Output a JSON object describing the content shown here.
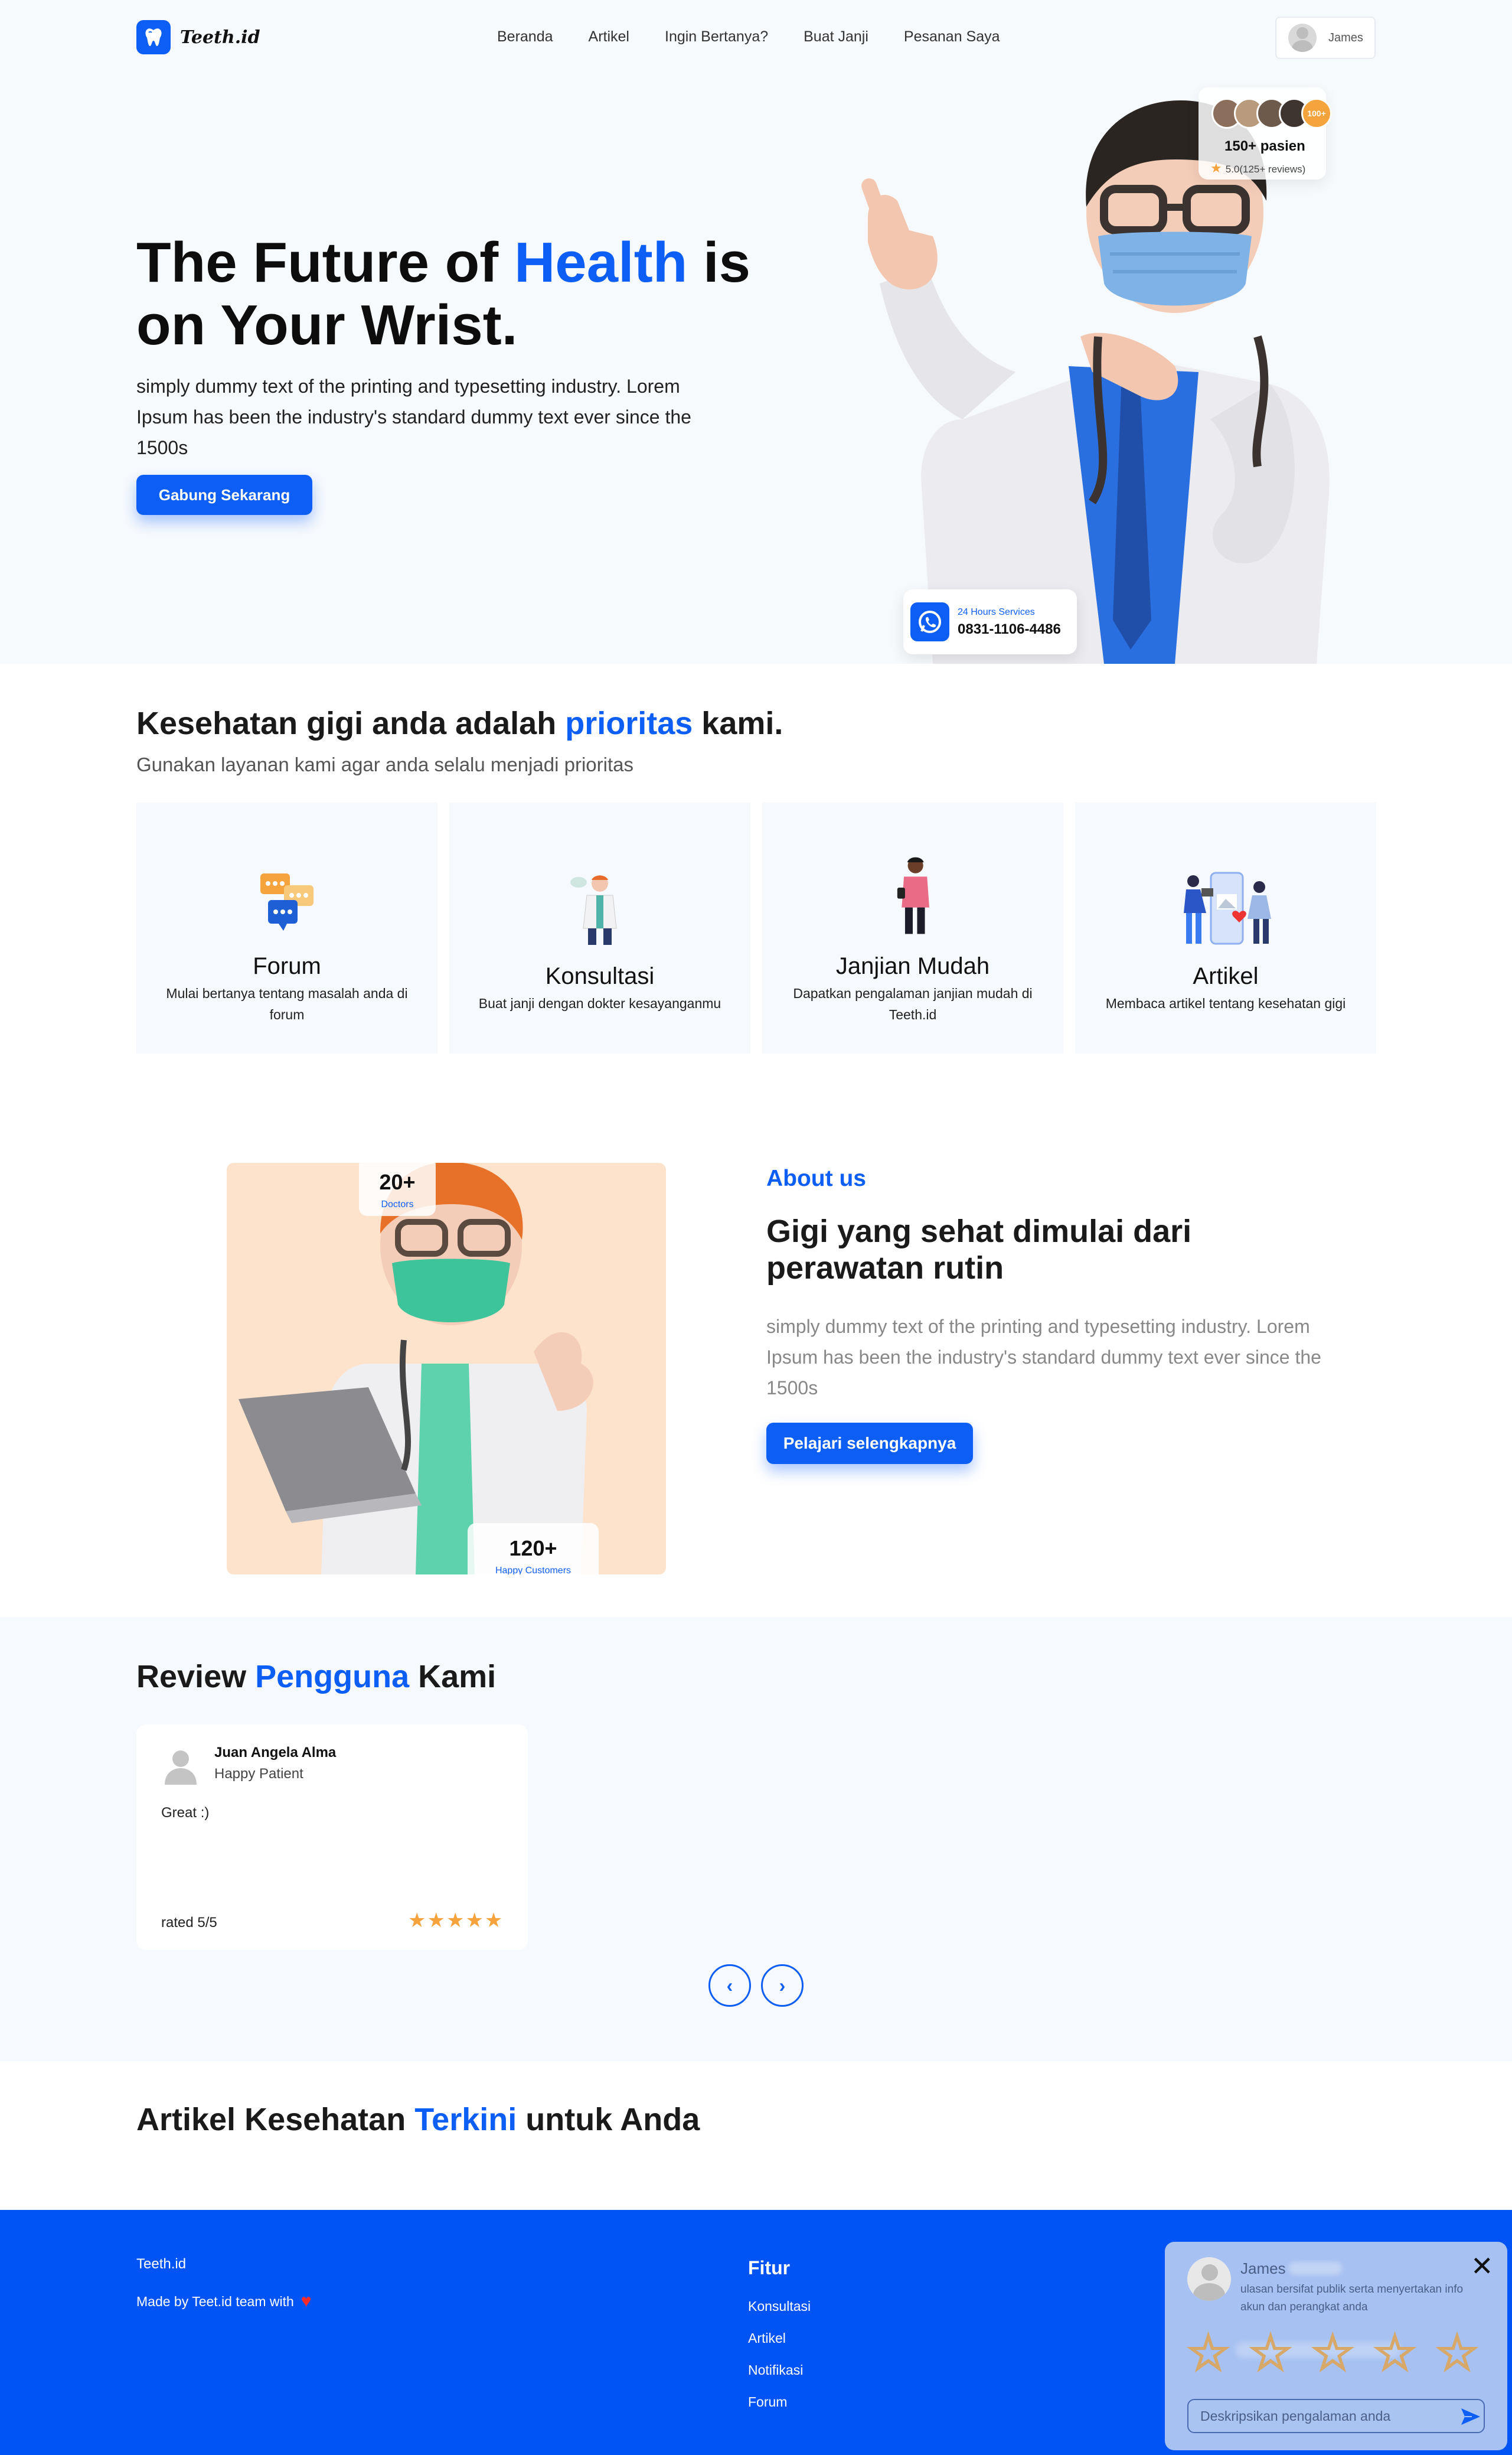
{
  "nav": {
    "brand": "Teeth.id",
    "menu": [
      "Beranda",
      "Artikel",
      "Ingin Bertanya?",
      "Buat Janji",
      "Pesanan Saya"
    ],
    "user": "James"
  },
  "hero": {
    "title_a": "The Future of ",
    "title_highlight": "Health",
    "title_b": " is on Your Wrist.",
    "subtitle": "simply dummy text of the printing and typesetting industry. Lorem Ipsum has been the industry's standard dummy text ever since the 1500s",
    "cta": "Gabung Sekarang",
    "patients_badge": "100+",
    "patients_title": "150+ pasien",
    "patients_rating": "5.0(125+ reviews)",
    "service_label": "24 Hours Services",
    "service_phone": "0831-1106-4486"
  },
  "services": {
    "title_a": "Kesehatan gigi anda adalah ",
    "title_highlight": "prioritas",
    "title_b": " kami.",
    "subtitle": "Gunakan layanan kami agar anda selalu menjadi prioritas",
    "cards": [
      {
        "title": "Forum",
        "desc": "Mulai bertanya tentang masalah anda di forum",
        "icon": "chat-bubbles-icon"
      },
      {
        "title": "Konsultasi",
        "desc": "Buat janji dengan dokter kesayanganmu",
        "icon": "doctor-icon"
      },
      {
        "title": "Janjian Mudah",
        "desc": "Dapatkan pengalaman janjian mudah di Teeth.id",
        "icon": "person-phone-icon"
      },
      {
        "title": "Artikel",
        "desc": "Membaca artikel tentang kesehatan gigi",
        "icon": "article-phone-icon"
      }
    ]
  },
  "about": {
    "kicker": "About us",
    "title": "Gigi yang sehat dimulai dari perawatan rutin",
    "text": "simply dummy text of the printing and typesetting industry. Lorem Ipsum has been the industry's standard dummy text ever since the 1500s",
    "cta": "Pelajari selengkapnya",
    "stat_doctors_value": "20+",
    "stat_doctors_label": "Doctors",
    "stat_customers_value": "120+",
    "stat_customers_label": "Happy Customers"
  },
  "reviews": {
    "title_a": "Review ",
    "title_highlight": "Pengguna",
    "title_b": " Kami",
    "items": [
      {
        "name": "Juan Angela Alma",
        "role": "Happy Patient",
        "text": "Great :)",
        "rated": "rated 5/5",
        "stars": "★★★★★",
        "rating": 5
      }
    ],
    "prev": "‹",
    "next": "›"
  },
  "articles": {
    "title_a": "Artikel Kesehatan ",
    "title_highlight": "Terkini",
    "title_b": " untuk Anda"
  },
  "footer": {
    "brand": "Teeth.id",
    "made_by": "Made by Teet.id team with",
    "heart": "♥",
    "features_title": "Fitur",
    "features": [
      "Konsultasi",
      "Artikel",
      "Notifikasi",
      "Forum"
    ]
  },
  "feedback": {
    "name": "James",
    "note": "ulasan bersifat publik serta menyertakan info akun dan perangkat anda",
    "close": "✕",
    "placeholder": "Deskripsikan pengalaman anda",
    "star_glyph": "☆"
  },
  "colors": {
    "brand_blue": "#0d5ef5",
    "footer_blue": "#0054f5",
    "star_orange": "#f5a33c"
  }
}
